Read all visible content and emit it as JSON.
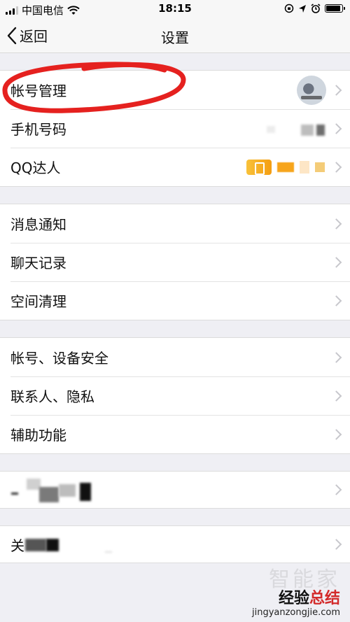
{
  "status_bar": {
    "carrier": "中国电信",
    "time": "18:15",
    "signal_level": 3,
    "battery_level": 0.9,
    "icons": [
      "signal-icon",
      "wifi-icon",
      "orientation-lock-icon",
      "location-icon",
      "alarm-icon",
      "battery-icon"
    ]
  },
  "nav": {
    "back_label": "返回",
    "title": "设置"
  },
  "groups": [
    {
      "items": [
        {
          "label": "帐号管理",
          "accessory": "avatar"
        },
        {
          "label": "手机号码",
          "accessory": "blurred-phone"
        },
        {
          "label": "QQ达人",
          "accessory": "qq-expert-badge"
        }
      ]
    },
    {
      "items": [
        {
          "label": "消息通知"
        },
        {
          "label": "聊天记录"
        },
        {
          "label": "空间清理"
        }
      ]
    },
    {
      "items": [
        {
          "label": "帐号、设备安全"
        },
        {
          "label": "联系人、隐私"
        },
        {
          "label": "辅助功能"
        }
      ]
    },
    {
      "items": [
        {
          "label": "",
          "note": "blurred"
        }
      ]
    },
    {
      "items": [
        {
          "label": "关",
          "note": "blurred"
        }
      ]
    }
  ],
  "annotation": {
    "color": "#e5211f",
    "target": "帐号管理"
  },
  "watermark": {
    "ghost": "智能家",
    "brand_part1": "经验",
    "brand_part2": "总结",
    "url": "jingyanzongjie.com"
  },
  "colors": {
    "background": "#efeff4",
    "accent_red": "#e5211f",
    "qq_orange": "#f7a51c"
  }
}
